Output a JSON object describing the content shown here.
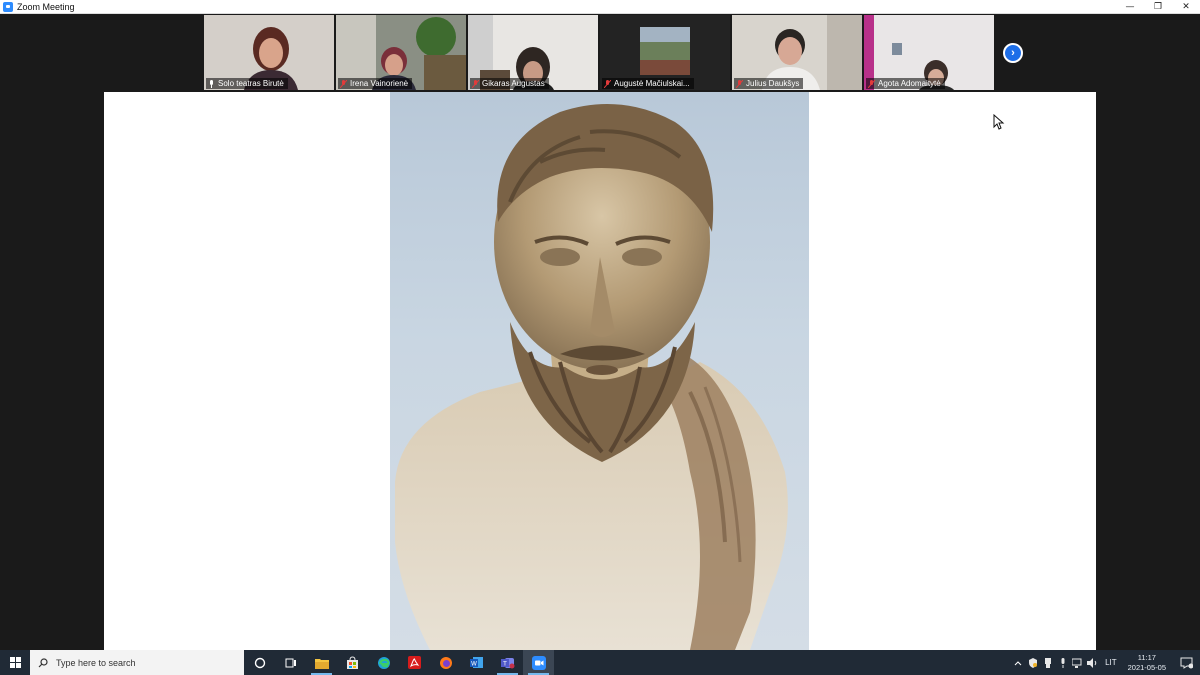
{
  "window": {
    "title": "Zoom Meeting",
    "minimize": "—",
    "restore": "❐",
    "close": "✕"
  },
  "participants": [
    {
      "name": "Solo teatras  Birutė",
      "active": true
    },
    {
      "name": "Irena Vainorienė",
      "active": false
    },
    {
      "name": "Gikaras Augustas",
      "active": false
    },
    {
      "name": "Augustė Mačiulskai...",
      "active": false
    },
    {
      "name": "Julius Daukšys",
      "active": false
    },
    {
      "name": "Agota Adomaitytė",
      "active": false
    }
  ],
  "strip": {
    "next_label": "›"
  },
  "taskbar": {
    "search_placeholder": "Type here to search",
    "apps": [
      "cortana-icon",
      "task-view-icon",
      "file-explorer-icon",
      "store-icon",
      "edge-icon",
      "acrobat-icon",
      "firefox-icon",
      "word-icon",
      "teams-icon",
      "zoom-icon"
    ],
    "language": "LIT",
    "time": "11:17",
    "date": "2021-05-05"
  },
  "colors": {
    "accent": "#2d8cff",
    "active_speaker": "#b8d63b",
    "taskbar": "#202a36"
  }
}
